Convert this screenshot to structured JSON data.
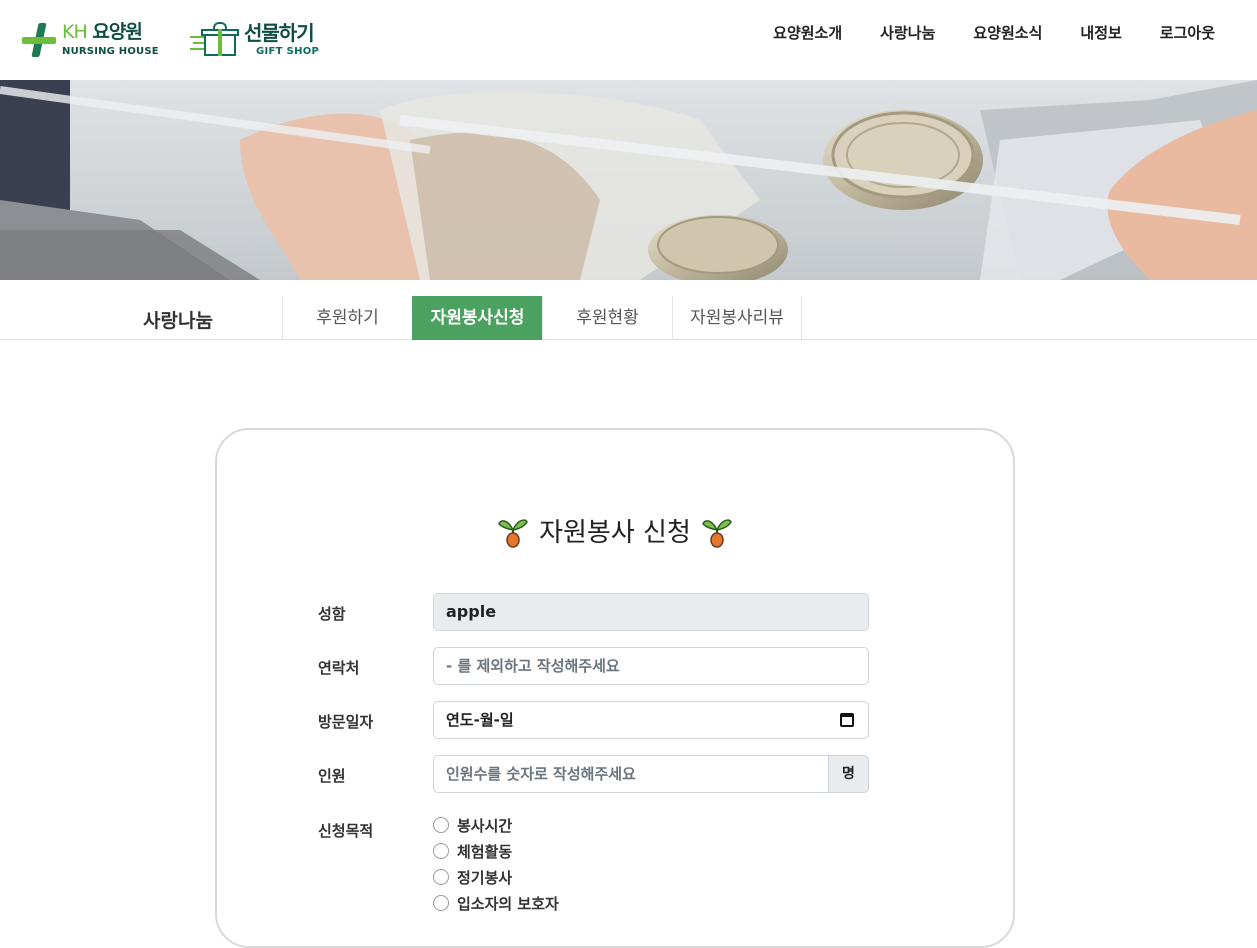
{
  "header": {
    "logo": {
      "prefix": "KH",
      "name": "요양원",
      "sub": "NURSING HOUSE"
    },
    "gift": {
      "name": "선물하기",
      "sub": "GIFT SHOP"
    },
    "nav": [
      "요양원소개",
      "사랑나눔",
      "요양원소식",
      "내정보",
      "로그아웃"
    ]
  },
  "subnav": {
    "title": "사랑나눔",
    "tabs": [
      "후원하기",
      "자원봉사신청",
      "후원현황",
      "자원봉사리뷰"
    ],
    "active_index": 1
  },
  "form": {
    "title": "자원봉사 신청",
    "title_icon": "sprout-icon",
    "name_label": "성함",
    "name_value": "apple",
    "contact_label": "연락처",
    "contact_placeholder": "- 를 제외하고 작성해주세요",
    "date_label": "방문일자",
    "date_value": "연도-월-일",
    "people_label": "인원",
    "people_placeholder": "인원수를 숫자로 작성해주세요",
    "people_unit": "명",
    "purpose_label": "신청목적",
    "purpose_options": [
      "봉사시간",
      "체험활동",
      "정기봉사",
      "입소자의 보호자"
    ]
  },
  "colors": {
    "brand_dark": "#0f4d45",
    "brand_green": "#6bbd3c",
    "active_tab": "#4ba15f"
  }
}
